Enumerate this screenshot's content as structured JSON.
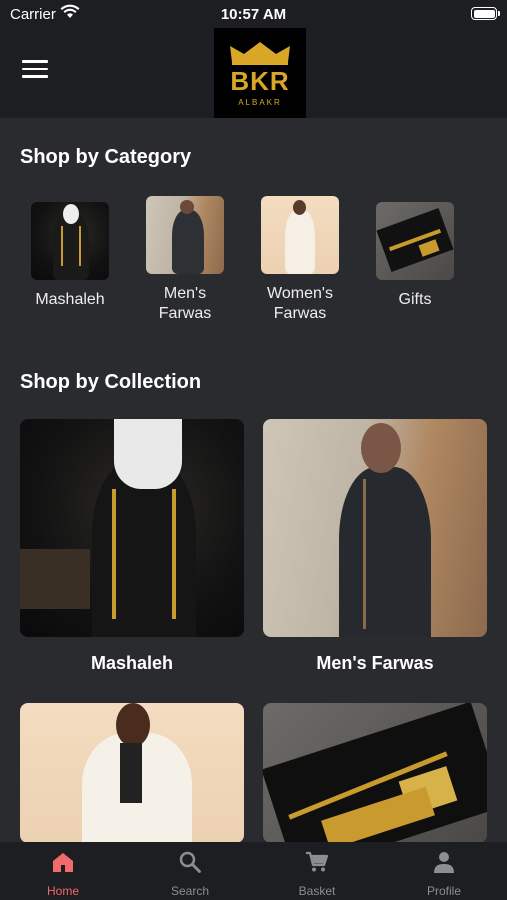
{
  "status_bar": {
    "carrier": "Carrier",
    "time": "10:57 AM"
  },
  "header": {
    "logo_text": "BKR",
    "logo_subtext": "ALBAKR",
    "menu_icon": "hamburger-icon"
  },
  "sections": {
    "category_title": "Shop by Category",
    "collection_title": "Shop by Collection"
  },
  "categories": [
    {
      "label": "Mashaleh"
    },
    {
      "label": "Men's\nFarwas"
    },
    {
      "label": "Women's\nFarwas"
    },
    {
      "label": "Gifts"
    }
  ],
  "collections": [
    {
      "title": "Mashaleh"
    },
    {
      "title": "Men's Farwas"
    },
    {
      "title": ""
    },
    {
      "title": ""
    }
  ],
  "tabbar": {
    "items": [
      {
        "label": "Home",
        "icon": "home-icon",
        "active": true
      },
      {
        "label": "Search",
        "icon": "search-icon",
        "active": false
      },
      {
        "label": "Basket",
        "icon": "cart-icon",
        "active": false
      },
      {
        "label": "Profile",
        "icon": "person-icon",
        "active": false
      }
    ],
    "active_color": "#f0696b",
    "inactive_color": "#8d8e92"
  },
  "colors": {
    "background": "#2a2b2f",
    "header": "#1d1e22",
    "brand_gold": "#d9a626"
  }
}
